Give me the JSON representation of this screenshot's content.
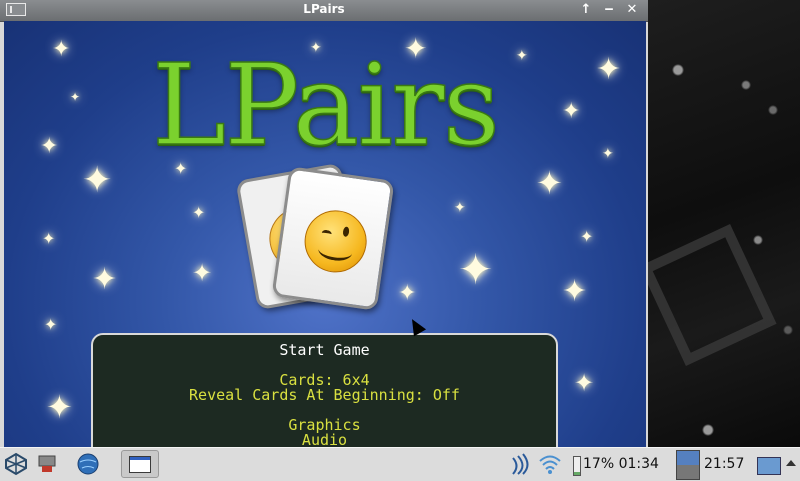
{
  "window": {
    "title": "LPairs"
  },
  "game": {
    "logo": "LPairs",
    "menu": {
      "start": "Start Game",
      "cards": "Cards: 6x4",
      "reveal": "Reveal Cards At Beginning: Off",
      "graphics": "Graphics",
      "audio": "Audio"
    }
  },
  "taskbar": {
    "battery": "17% 01:34",
    "clock": "21:57"
  },
  "colors": {
    "logo": "#7bd12e",
    "panel": "#1d2a22",
    "menu_yellow": "#d9e040",
    "background_blue": "#2a4c9c"
  }
}
